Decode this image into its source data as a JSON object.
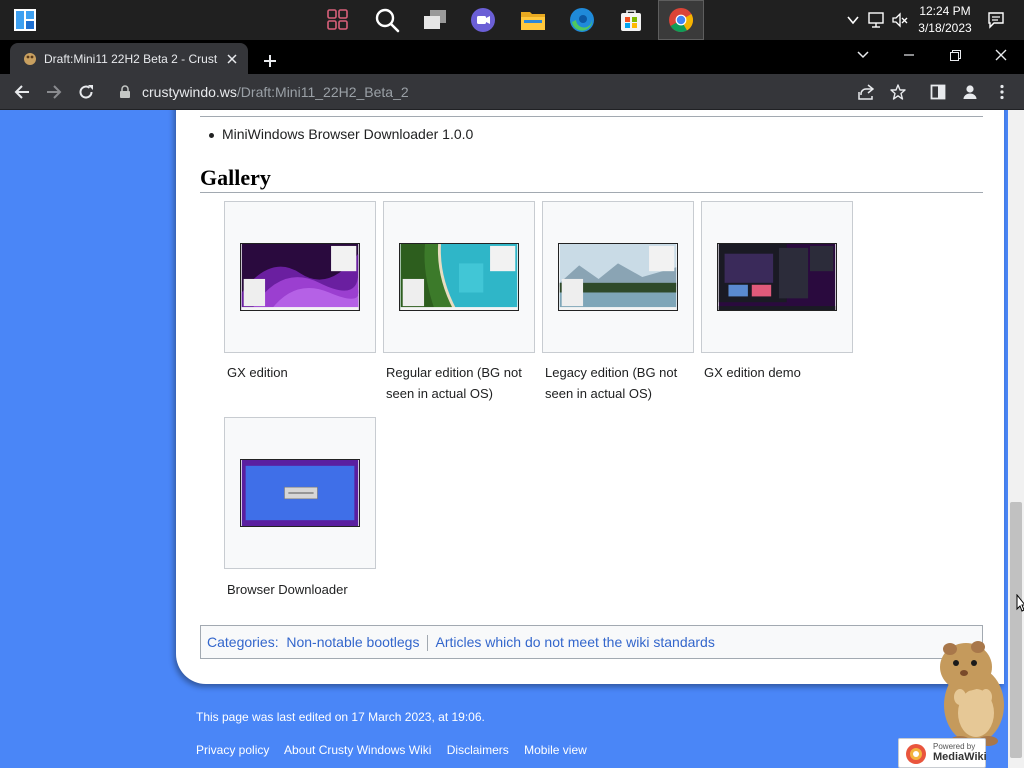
{
  "taskbar": {
    "apps": [
      {
        "name": "start-button",
        "icon": "windows-logo-icon"
      },
      {
        "name": "widgets-button",
        "icon": "widgets-grid-icon"
      },
      {
        "name": "search-button",
        "icon": "search-icon"
      },
      {
        "name": "task-view-button",
        "icon": "task-view-icon"
      },
      {
        "name": "teams-chat-button",
        "icon": "teams-chat-icon"
      },
      {
        "name": "file-explorer-button",
        "icon": "folder-icon"
      },
      {
        "name": "edge-button",
        "icon": "edge-icon"
      },
      {
        "name": "store-button",
        "icon": "store-icon"
      },
      {
        "name": "chrome-button",
        "icon": "chrome-icon"
      }
    ],
    "clock": {
      "time": "12:24 PM",
      "date": "3/18/2023"
    }
  },
  "browser": {
    "tab_title": "Draft:Mini11 22H2 Beta 2 - Crust",
    "url_domain": "crustywindo.ws",
    "url_path": "/Draft:Mini11_22H2_Beta_2"
  },
  "page": {
    "list_item": "MiniWindows Browser Downloader 1.0.0",
    "gallery_heading": "Gallery",
    "gallery": [
      {
        "caption": "GX edition",
        "theme": "gx-purple-wallpaper"
      },
      {
        "caption": "Regular edition (BG not seen in actual OS)",
        "theme": "aerial-coast-wallpaper"
      },
      {
        "caption": "Legacy edition (BG not seen in actual OS)",
        "theme": "mountain-lake-wallpaper"
      },
      {
        "caption": "GX edition demo",
        "theme": "gx-dark-desktop"
      },
      {
        "caption": "Browser Downloader",
        "theme": "blue-downloader-window"
      }
    ],
    "categories": {
      "label": "Categories",
      "items": [
        "Non-notable bootlegs",
        "Articles which do not meet the wiki standards"
      ]
    },
    "footer": {
      "last_edited": "This page was last edited on 17 March 2023, at 19:06.",
      "links": [
        "Privacy policy",
        "About Crusty Windows Wiki",
        "Disclaimers",
        "Mobile view"
      ],
      "badge_top": "Powered by",
      "badge_bottom": "MediaWiki"
    }
  },
  "colors": {
    "page_background": "#4a86f7",
    "link": "#3366cc",
    "taskbar": "#202020",
    "browser_toolbar": "#35363a"
  }
}
